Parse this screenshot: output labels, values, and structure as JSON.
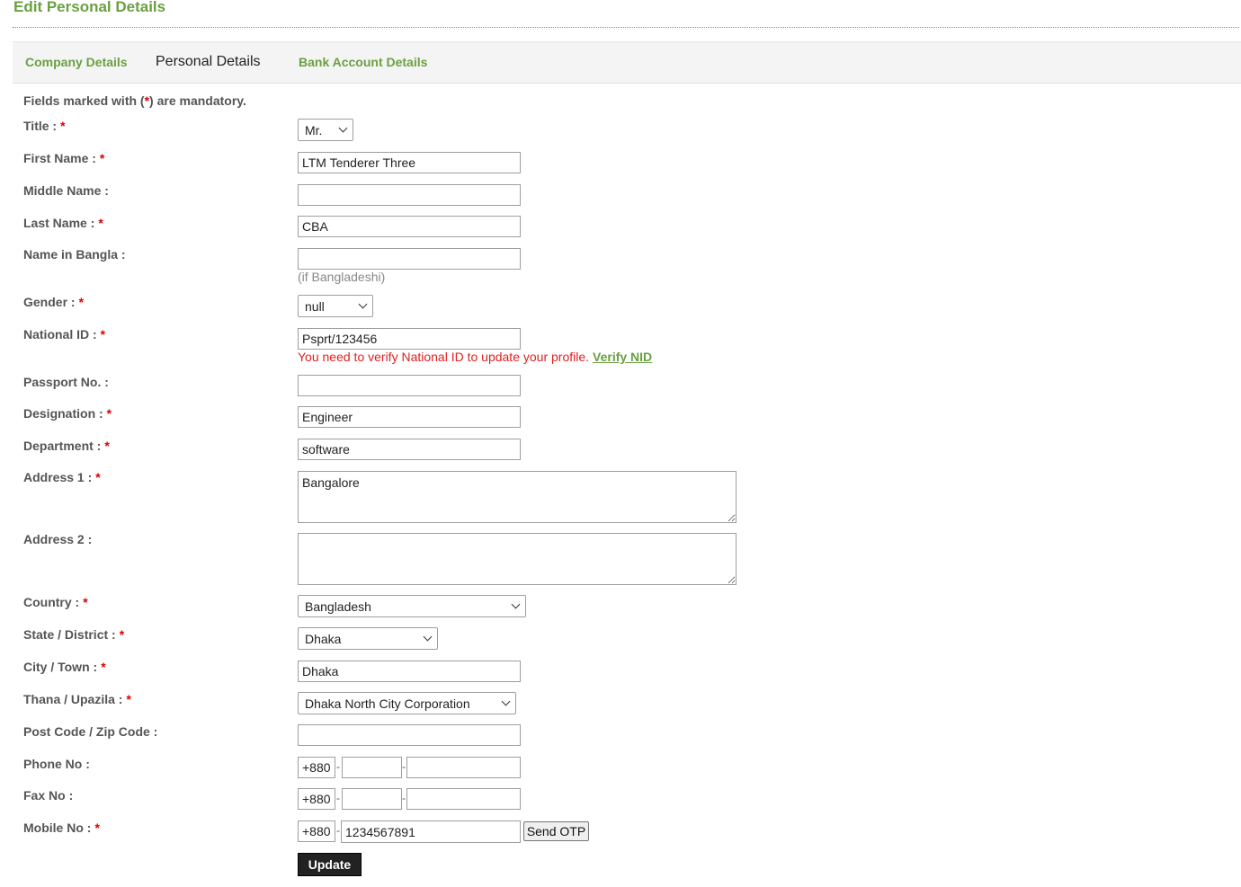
{
  "page": {
    "title": "Edit Personal Details"
  },
  "tabs": [
    {
      "label": "Company Details"
    },
    {
      "label": "Personal Details"
    },
    {
      "label": "Bank Account Details"
    }
  ],
  "note": {
    "prefix": "Fields marked with (",
    "star": "*",
    "suffix": ") are mandatory."
  },
  "required_mark": "*",
  "fields": {
    "title": {
      "label": "Title :",
      "value": "Mr."
    },
    "first_name": {
      "label": "First Name :",
      "value": "LTM Tenderer Three"
    },
    "middle_name": {
      "label": "Middle Name :",
      "value": ""
    },
    "last_name": {
      "label": "Last Name :",
      "value": "CBA"
    },
    "name_bangla": {
      "label": "Name in Bangla :",
      "value": "",
      "hint": "(if Bangladeshi)"
    },
    "gender": {
      "label": "Gender :",
      "value": "null"
    },
    "national_id": {
      "label": "National ID :",
      "value": "Psprt/123456",
      "error": "You need to verify National ID to update your profile.",
      "verify_link": "Verify NID"
    },
    "passport": {
      "label": "Passport No. :",
      "value": ""
    },
    "designation": {
      "label": "Designation :",
      "value": "Engineer"
    },
    "department": {
      "label": "Department :",
      "value": "software"
    },
    "address1": {
      "label": "Address 1 :",
      "value": "Bangalore"
    },
    "address2": {
      "label": "Address 2 :",
      "value": ""
    },
    "country": {
      "label": "Country :",
      "value": "Bangladesh"
    },
    "state": {
      "label": "State / District :",
      "value": "Dhaka"
    },
    "city": {
      "label": "City / Town :",
      "value": "Dhaka"
    },
    "thana": {
      "label": "Thana / Upazila :",
      "value": "Dhaka North City Corporation"
    },
    "postcode": {
      "label": "Post Code / Zip Code :",
      "value": ""
    },
    "phone": {
      "label": "Phone No :",
      "country_code": "+880",
      "area": "",
      "number": ""
    },
    "fax": {
      "label": "Fax No :",
      "country_code": "+880",
      "area": "",
      "number": ""
    },
    "mobile": {
      "label": "Mobile No :",
      "country_code": "+880",
      "number": "1234567891"
    }
  },
  "dash": "-",
  "buttons": {
    "send_otp": "Send OTP",
    "update": "Update"
  }
}
